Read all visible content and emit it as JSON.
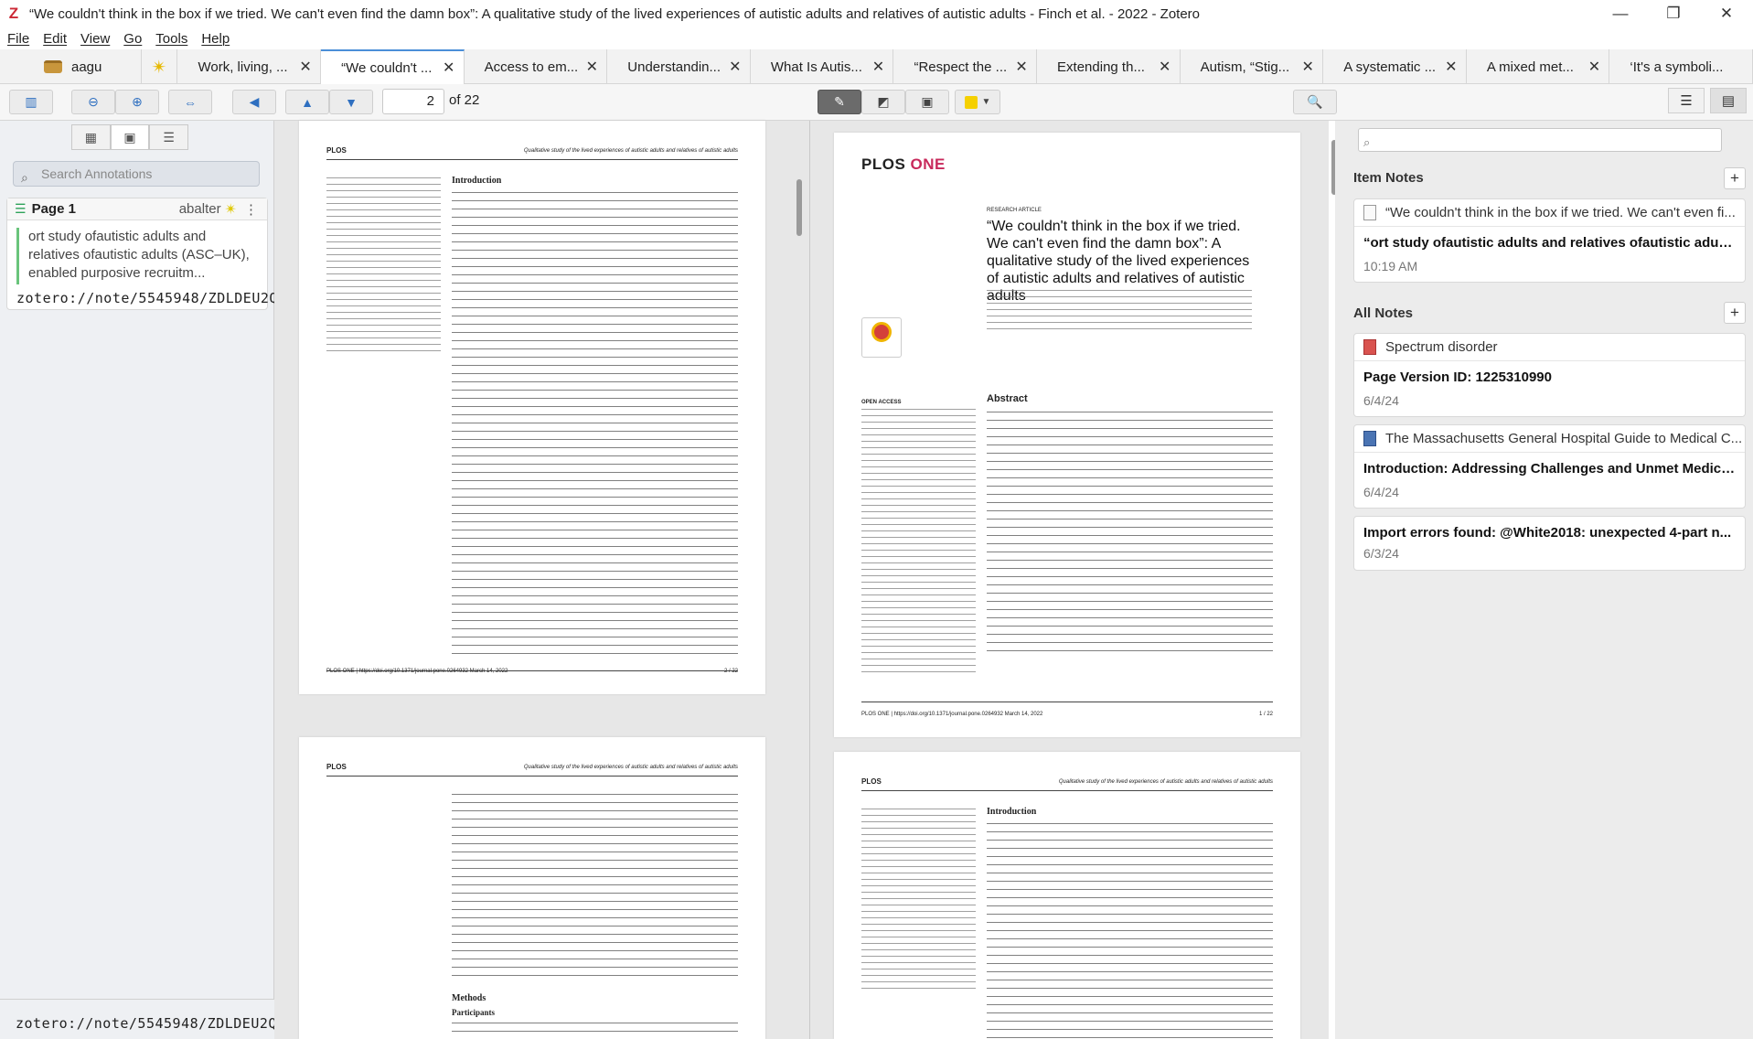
{
  "window": {
    "title": "“We couldn't think in the box if we tried. We can't even find the damn box”: A qualitative study of the lived experiences of autistic adults and relatives of autistic adults - Finch et al. - 2022 - Zotero",
    "logo": "Z",
    "minimize": "—",
    "maximize": "❐",
    "close": "✕"
  },
  "menu": [
    "File",
    "Edit",
    "View",
    "Go",
    "Tools",
    "Help"
  ],
  "tabs": [
    {
      "label": "aagu"
    },
    {
      "label": "Work, living, ..."
    },
    {
      "label": "“We couldn't ..."
    },
    {
      "label": "Access to em..."
    },
    {
      "label": "Understandin..."
    },
    {
      "label": "What Is Autis..."
    },
    {
      "label": "“Respect the ..."
    },
    {
      "label": "Extending th..."
    },
    {
      "label": "Autism, “Stig..."
    },
    {
      "label": "A systematic ..."
    },
    {
      "label": "A mixed met..."
    },
    {
      "label": "‘It's a symboli..."
    }
  ],
  "toolbar": {
    "page": "2",
    "of": "of 22",
    "highlight_color": "#f5d000"
  },
  "annotations": {
    "search_placeholder": "Search Annotations",
    "items": [
      {
        "page": "Page 1",
        "author": "abalter",
        "text": "ort study ofautistic adults and relatives ofautistic adults (ASC–UK), enabled purposive recruitm...",
        "link": "zotero://note/5545948/ZDLDEU2Q/"
      }
    ]
  },
  "status": "zotero://note/5545948/ZDLDEU2Q/",
  "pdf": {
    "journal_a": "PLOS",
    "journal_b": "ONE",
    "running_head": "Qualitative study of the lived experiences of autistic adults and relatives of autistic adults",
    "research_article": "RESEARCH ARTICLE",
    "title": "“We couldn't think in the box if we tried. We can't even find the damn box”: A qualitative study of the lived experiences of autistic adults and relatives of autistic adults",
    "abstract_head": "Abstract",
    "intro_head": "Introduction",
    "methods_head": "Methods",
    "participants_head": "Participants",
    "open_access": "OPEN ACCESS",
    "check_updates": "Check for updates",
    "footer_left": "PLOS ONE | https://doi.org/10.1371/journal.pone.0264932   March 14, 2022",
    "page_num_2": "2 / 22",
    "page_num_1": "1 / 22"
  },
  "notes": {
    "item_notes_header": "Item Notes",
    "all_notes_header": "All Notes",
    "item_notes": [
      {
        "parent": "“We couldn't think in the box if we tried. We can't even fi...",
        "title": "“ort study ofautistic adults and relatives ofautistic adult...",
        "date": "10:19 AM"
      }
    ],
    "all_notes": [
      {
        "parent": "Spectrum disorder",
        "title": "Page Version ID: 1225310990",
        "date": "6/4/24"
      },
      {
        "parent": "The Massachusetts General Hospital Guide to Medical C...",
        "title": "Introduction: Addressing Challenges and Unmet Medical...",
        "date": "6/4/24"
      },
      {
        "title": "Import errors found: @White2018: unexpected 4-part n...",
        "date": "6/3/24"
      }
    ]
  }
}
